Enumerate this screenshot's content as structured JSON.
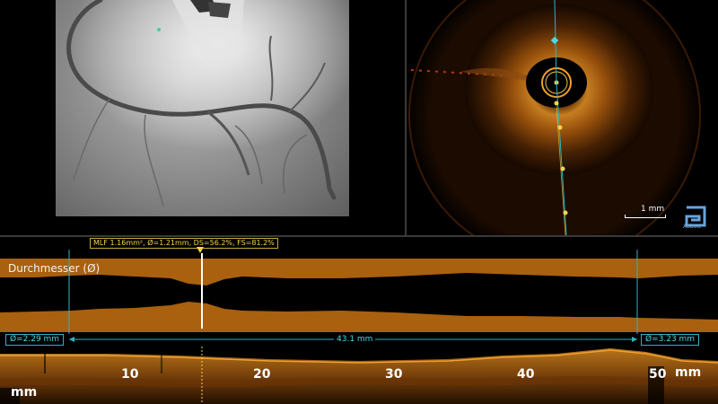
{
  "oct": {
    "scale_label": "1 mm",
    "brand_label": "Abbott"
  },
  "profile": {
    "title": "Durchmesser (Ø)",
    "mlf_info": "MLF 1.16mm², Ø=1.21mm, DS=56.2%, FS=81.2%",
    "left_diameter": "Ø=2.29 mm",
    "right_diameter": "Ø=3.23 mm",
    "length": "43.1 mm"
  },
  "longitudinal": {
    "ticks": [
      "10",
      "20",
      "30",
      "40",
      "50"
    ],
    "unit_left": "mm",
    "unit_right": "mm"
  },
  "colors": {
    "profile_fill": "#a9600f",
    "cyan_marker": "#2bb5bf",
    "yellow_marker": "#f5d547",
    "oct_tissue": "#c8781a"
  }
}
